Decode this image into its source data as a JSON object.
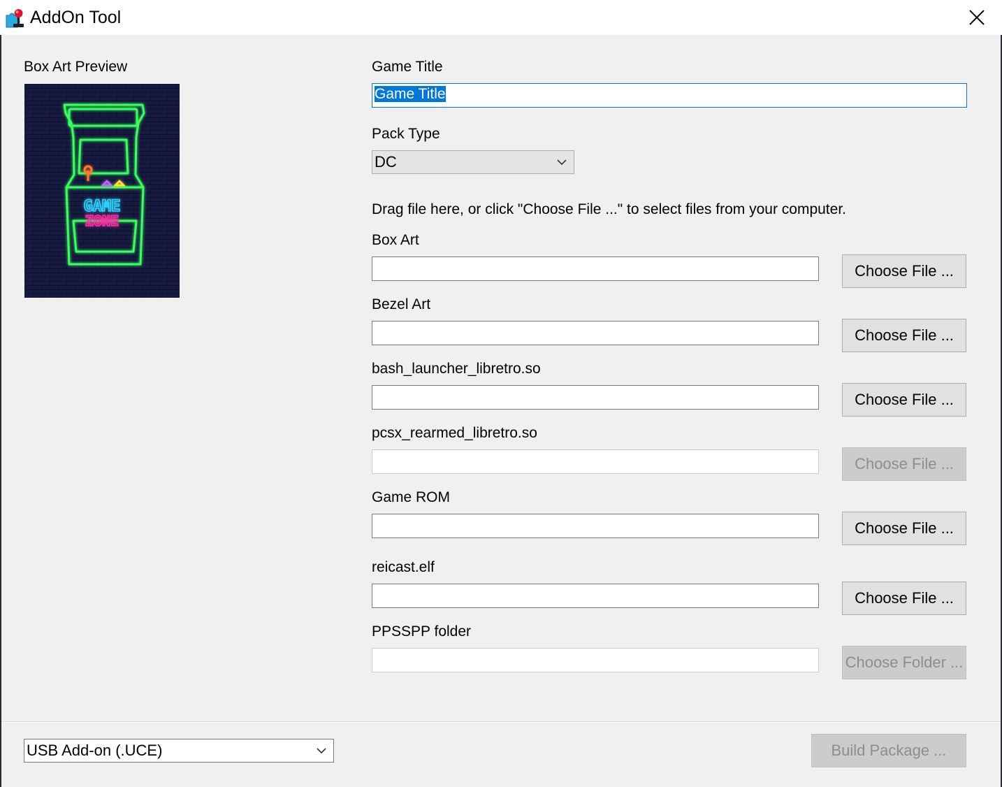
{
  "window": {
    "title": "AddOn Tool",
    "app_icon": "puzzle-joystick-icon",
    "close_icon": "close-icon"
  },
  "preview": {
    "label": "Box Art Preview",
    "art_text_line1": "GAME",
    "art_text_line2": "ZONE",
    "colors": {
      "background": "#15183a",
      "cabinet": "#39ff5a",
      "line1": "#2fd4ff",
      "line2": "#ff2fa8"
    }
  },
  "form": {
    "game_title_label": "Game Title",
    "game_title_value": "Game Title",
    "pack_type_label": "Pack Type",
    "pack_type_value": "DC",
    "instructions": "Drag file here, or click \"Choose File ...\" to select files from your computer.",
    "fields": [
      {
        "label": "Box Art",
        "value": "",
        "button": "Choose File ...",
        "enabled": true
      },
      {
        "label": "Bezel Art",
        "value": "",
        "button": "Choose File ...",
        "enabled": true
      },
      {
        "label": "bash_launcher_libretro.so",
        "value": "",
        "button": "Choose File ...",
        "enabled": true
      },
      {
        "label": "pcsx_rearmed_libretro.so",
        "value": "",
        "button": "Choose File ...",
        "enabled": false
      },
      {
        "label": "Game ROM",
        "value": "",
        "button": "Choose File ...",
        "enabled": true
      },
      {
        "label": "reicast.elf",
        "value": "",
        "button": "Choose File ...",
        "enabled": true
      },
      {
        "label": "PPSSPP folder",
        "value": "",
        "button": "Choose Folder ...",
        "enabled": false
      }
    ]
  },
  "footer": {
    "package_format": "USB Add-on (.UCE)",
    "build_button": "Build Package ..."
  },
  "colors": {
    "accent": "#0078d7",
    "window_bg": "#f0f0f0",
    "disabled_text": "#8d8d8d"
  }
}
